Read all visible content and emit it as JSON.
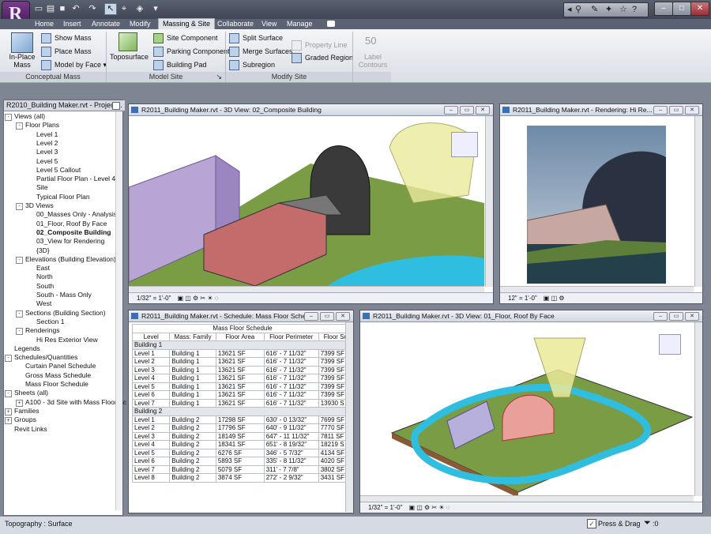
{
  "app": {
    "window_controls": [
      "–",
      "□",
      "✕"
    ]
  },
  "qat_icons": [
    "open-icon",
    "folder-icon",
    "save-icon",
    "undo-icon",
    "redo-icon",
    "select-icon",
    "measure-icon",
    "view3d-icon"
  ],
  "tabs": [
    "Home",
    "Insert",
    "Annotate",
    "Modify",
    "Massing & Site",
    "Collaborate",
    "View",
    "Manage"
  ],
  "active_tab": "Massing & Site",
  "ribbon": {
    "inplace_mass": "In-Place Mass",
    "show_mass": "Show Mass",
    "place_mass": "Place Mass",
    "model_by_face": "Model by Face",
    "toposurface": "Toposurface",
    "site_component": "Site Component",
    "parking_component": "Parking Component",
    "building_pad": "Building Pad",
    "split_surface": "Split Surface",
    "merge_surfaces": "Merge Surfaces",
    "subregion": "Subregion",
    "property_line": "Property Line",
    "graded_region": "Graded Region",
    "label_contours": "Label Contours",
    "label_contours_num": "50",
    "panel_conceptual": "Conceptual Mass",
    "panel_model_site": "Model Site",
    "panel_modify_site": "Modify Site"
  },
  "browser": {
    "title": "R2010_Building Maker.rvt - Project...",
    "nodes": [
      {
        "t": "Views (all)",
        "lvl": 0,
        "exp": "-",
        "b": false
      },
      {
        "t": "Floor Plans",
        "lvl": 1,
        "exp": "-",
        "b": false
      },
      {
        "t": "Level 1",
        "lvl": 2,
        "exp": "",
        "b": false
      },
      {
        "t": "Level 2",
        "lvl": 2,
        "exp": "",
        "b": false
      },
      {
        "t": "Level 3",
        "lvl": 2,
        "exp": "",
        "b": false
      },
      {
        "t": "Level 5",
        "lvl": 2,
        "exp": "",
        "b": false
      },
      {
        "t": "Level 5 Callout",
        "lvl": 2,
        "exp": "",
        "b": false
      },
      {
        "t": "Partial Floor Plan - Level 4",
        "lvl": 2,
        "exp": "",
        "b": false
      },
      {
        "t": "Site",
        "lvl": 2,
        "exp": "",
        "b": false
      },
      {
        "t": "Typical Floor Plan",
        "lvl": 2,
        "exp": "",
        "b": false
      },
      {
        "t": "3D Views",
        "lvl": 1,
        "exp": "-",
        "b": false
      },
      {
        "t": "00_Masses Only - Analysis",
        "lvl": 2,
        "exp": "",
        "b": false
      },
      {
        "t": "01_Floor, Roof By Face",
        "lvl": 2,
        "exp": "",
        "b": false
      },
      {
        "t": "02_Composite Building",
        "lvl": 2,
        "exp": "",
        "b": true
      },
      {
        "t": "03_View for Rendering",
        "lvl": 2,
        "exp": "",
        "b": false
      },
      {
        "t": "{3D}",
        "lvl": 2,
        "exp": "",
        "b": false
      },
      {
        "t": "Elevations (Building Elevation)",
        "lvl": 1,
        "exp": "-",
        "b": false
      },
      {
        "t": "East",
        "lvl": 2,
        "exp": "",
        "b": false
      },
      {
        "t": "North",
        "lvl": 2,
        "exp": "",
        "b": false
      },
      {
        "t": "South",
        "lvl": 2,
        "exp": "",
        "b": false
      },
      {
        "t": "South - Mass Only",
        "lvl": 2,
        "exp": "",
        "b": false
      },
      {
        "t": "West",
        "lvl": 2,
        "exp": "",
        "b": false
      },
      {
        "t": "Sections (Building Section)",
        "lvl": 1,
        "exp": "-",
        "b": false
      },
      {
        "t": "Section 1",
        "lvl": 2,
        "exp": "",
        "b": false
      },
      {
        "t": "Renderings",
        "lvl": 1,
        "exp": "-",
        "b": false
      },
      {
        "t": "Hi Res Exterior View",
        "lvl": 2,
        "exp": "",
        "b": false
      },
      {
        "t": "Legends",
        "lvl": 0,
        "exp": "",
        "b": false
      },
      {
        "t": "Schedules/Quantities",
        "lvl": 0,
        "exp": "-",
        "b": false
      },
      {
        "t": "Curtain Panel Schedule",
        "lvl": 1,
        "exp": "",
        "b": false
      },
      {
        "t": "Gross Mass Schedule",
        "lvl": 1,
        "exp": "",
        "b": false
      },
      {
        "t": "Mass Floor Schedule",
        "lvl": 1,
        "exp": "",
        "b": false
      },
      {
        "t": "Sheets (all)",
        "lvl": 0,
        "exp": "-",
        "b": false
      },
      {
        "t": "A100 - 3d Site with Mass Floor Sc",
        "lvl": 1,
        "exp": "+",
        "b": false
      },
      {
        "t": "Families",
        "lvl": 0,
        "exp": "+",
        "b": false
      },
      {
        "t": "Groups",
        "lvl": 0,
        "exp": "+",
        "b": false
      },
      {
        "t": "Revit Links",
        "lvl": 0,
        "exp": "",
        "b": false
      }
    ]
  },
  "views": {
    "composite": {
      "title": "R2011_Building Maker.rvt - 3D View: 02_Composite Building",
      "scale": "1/32\" = 1'-0\""
    },
    "rendering": {
      "title": "R2011_Building Maker.rvt - Rendering: Hi Re...",
      "scale": "12\" = 1'-0\""
    },
    "schedule": {
      "title": "R2011_Building Maker.rvt - Schedule: Mass Floor Sche..."
    },
    "floorroof": {
      "title": "R2011_Building Maker.rvt - 3D View: 01_Floor, Roof By Face",
      "scale": "1/32\" = 1'-0\""
    }
  },
  "schedule": {
    "title": "Mass Floor Schedule",
    "headers": [
      "Level",
      "Mass: Family",
      "Floor Area",
      "Floor Perimeter",
      "Floor Su"
    ],
    "groups": [
      {
        "name": "Building 1",
        "rows": [
          [
            "Level 1",
            "Building 1",
            "13621 SF",
            "616' - 7 11/32\"",
            "7399 SF"
          ],
          [
            "Level 2",
            "Building 1",
            "13621 SF",
            "616' - 7 11/32\"",
            "7399 SF"
          ],
          [
            "Level 3",
            "Building 1",
            "13621 SF",
            "616' - 7 11/32\"",
            "7399 SF"
          ],
          [
            "Level 4",
            "Building 1",
            "13621 SF",
            "616' - 7 11/32\"",
            "7399 SF"
          ],
          [
            "Level 5",
            "Building 1",
            "13621 SF",
            "616' - 7 11/32\"",
            "7399 SF"
          ],
          [
            "Level 6",
            "Building 1",
            "13621 SF",
            "616' - 7 11/32\"",
            "7399 SF"
          ],
          [
            "Level 7",
            "Building 1",
            "13621 SF",
            "616' - 7 11/32\"",
            "13930 S"
          ]
        ]
      },
      {
        "name": "Building 2",
        "rows": [
          [
            "Level 1",
            "Building 2",
            "17298 SF",
            "630' - 0 13/32\"",
            "7699 SF"
          ],
          [
            "Level 2",
            "Building 2",
            "17796 SF",
            "640' - 9 11/32\"",
            "7770 SF"
          ],
          [
            "Level 3",
            "Building 2",
            "18149 SF",
            "647' - 11 11/32\"",
            "7811 SF"
          ],
          [
            "Level 4",
            "Building 2",
            "18341 SF",
            "651' - 8 19/32\"",
            "18219 S"
          ],
          [
            "Level 5",
            "Building 2",
            "6276 SF",
            "346' - 5 7/32\"",
            "4134 SF"
          ],
          [
            "Level 6",
            "Building 2",
            "5893 SF",
            "335' - 8 11/32\"",
            "4020 SF"
          ],
          [
            "Level 7",
            "Building 2",
            "5079 SF",
            "311' - 7 7/8\"",
            "3802 SF"
          ],
          [
            "Level 8",
            "Building 2",
            "3874 SF",
            "272' - 2 9/32\"",
            "3431 SF"
          ]
        ]
      }
    ]
  },
  "status": {
    "text": "Topography : Surface",
    "press_drag": "Press & Drag",
    "filter_count": ":0"
  },
  "colors": {
    "ribbon_bg": "#e6e9ee",
    "title_bar": "#4a5060",
    "mdi_bg": "#7e8593",
    "grass": "#7a9c45",
    "water": "#2fbde0"
  }
}
